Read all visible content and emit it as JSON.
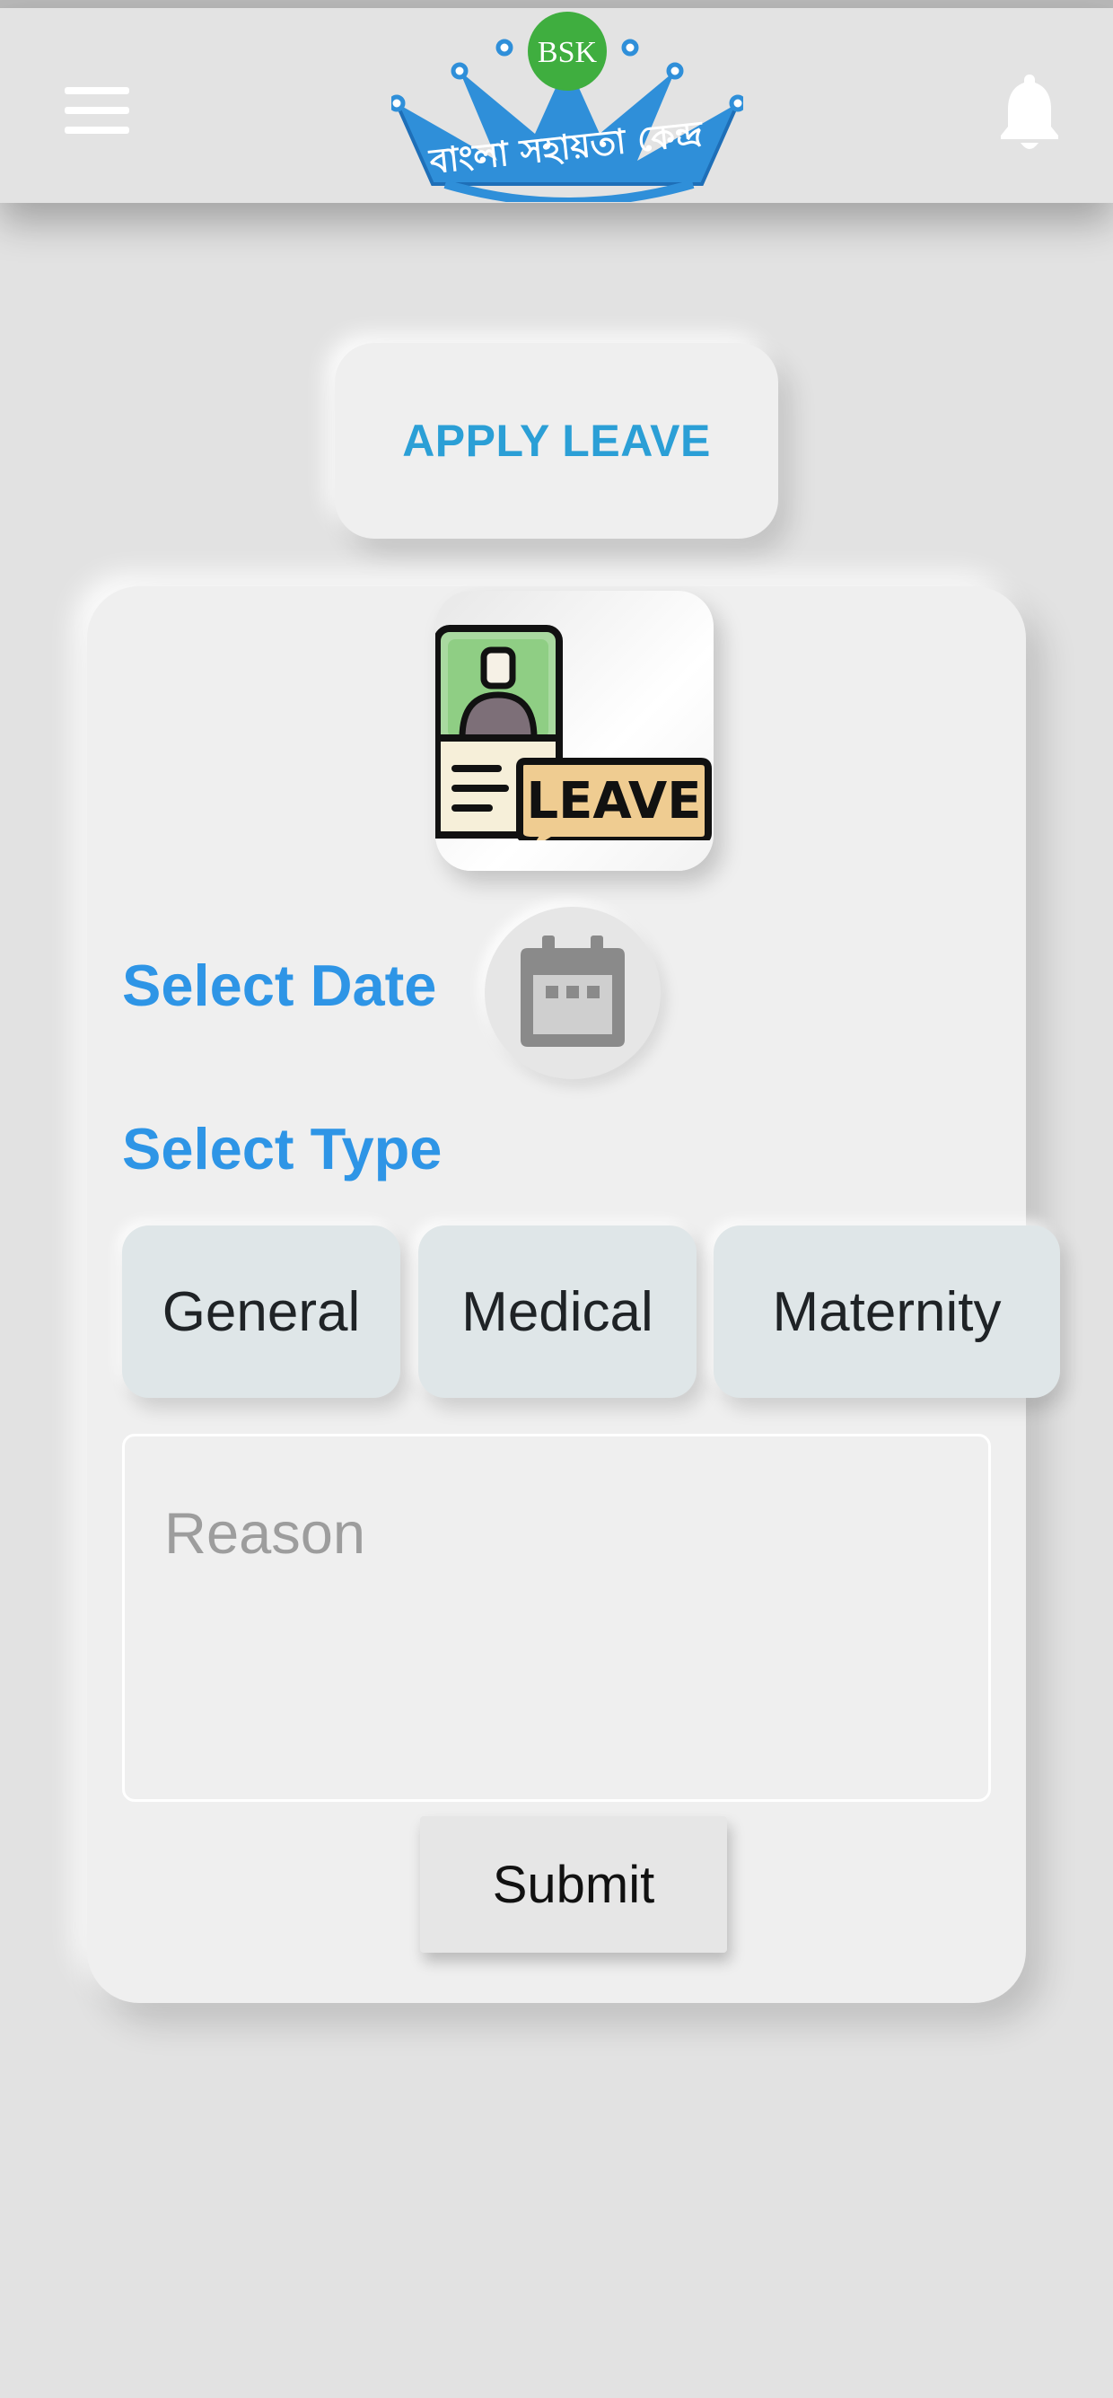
{
  "header": {
    "logo": {
      "badge_text": "BSK",
      "caption": "বাংলা সহায়তা কেন্দ্র"
    },
    "menu_icon": "hamburger-menu-icon",
    "notification_icon": "bell-icon"
  },
  "title_card": {
    "label": "APPLY LEAVE"
  },
  "leave_image": {
    "icon": "leave-document-icon",
    "badge_text": "LEAVE"
  },
  "select_date": {
    "label": "Select Date",
    "icon": "calendar-icon"
  },
  "select_type": {
    "label": "Select Type",
    "options": [
      {
        "label": "General"
      },
      {
        "label": "Medical"
      },
      {
        "label": "Maternity"
      }
    ]
  },
  "reason": {
    "placeholder": "Reason",
    "value": ""
  },
  "submit": {
    "label": "Submit"
  },
  "colors": {
    "accent_blue": "#2e95e6",
    "title_blue": "#2b9fd6",
    "background": "#e2e2e2",
    "card": "#efefef",
    "type_button": "#dfe6e8"
  }
}
